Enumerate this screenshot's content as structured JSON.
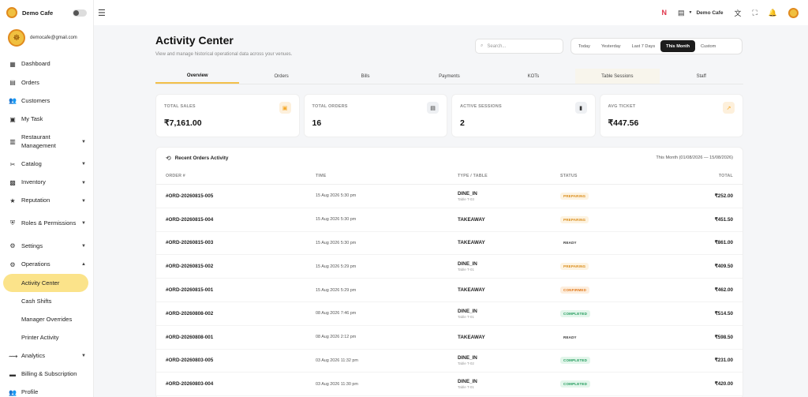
{
  "sidebar": {
    "brand_name": "Demo Cafe",
    "user_email": "democafe@gmail.com",
    "items": [
      {
        "name": "sidebar-item-dashboard",
        "label": "Dashboard",
        "icon": "grid",
        "chev": ""
      },
      {
        "name": "sidebar-item-orders",
        "label": "Orders",
        "icon": "receipt",
        "chev": ""
      },
      {
        "name": "sidebar-item-customers",
        "label": "Customers",
        "icon": "people",
        "chev": ""
      },
      {
        "name": "sidebar-item-my-task",
        "label": "My Task",
        "icon": "task",
        "chev": ""
      },
      {
        "name": "sidebar-item-restaurant-management",
        "label": "Restaurant Management",
        "icon": "store",
        "chev": "▼",
        "tall": true
      },
      {
        "name": "sidebar-item-catalog",
        "label": "Catalog",
        "icon": "utensils",
        "chev": "▼"
      },
      {
        "name": "sidebar-item-inventory",
        "label": "Inventory",
        "icon": "box",
        "chev": "▼"
      },
      {
        "name": "sidebar-item-reputation",
        "label": "Reputation",
        "icon": "star",
        "chev": "▼"
      },
      {
        "name": "sidebar-item-roles-permissions",
        "label": "Roles & Permissions",
        "icon": "shield",
        "chev": "▼",
        "tall": true
      },
      {
        "name": "sidebar-item-settings",
        "label": "Settings",
        "icon": "gear",
        "chev": "▼"
      },
      {
        "name": "sidebar-item-operations",
        "label": "Operations",
        "icon": "ops",
        "chev": "▲"
      }
    ],
    "sub_items": [
      {
        "label": "Activity Center",
        "active": true
      },
      {
        "label": "Cash Shifts",
        "active": false
      },
      {
        "label": "Manager Overrides",
        "active": false
      },
      {
        "label": "Printer Activity",
        "active": false
      }
    ],
    "items_after": [
      {
        "name": "sidebar-item-analytics",
        "label": "Analytics",
        "icon": "chart",
        "chev": "▼"
      },
      {
        "name": "sidebar-item-billing-subscription",
        "label": "Billing & Subscription",
        "icon": "card",
        "chev": ""
      },
      {
        "name": "sidebar-item-profile",
        "label": "Profile",
        "icon": "people",
        "chev": ""
      }
    ]
  },
  "topbar": {
    "venue": "Demo Cafe"
  },
  "page": {
    "title": "Activity Center",
    "subtitle": "View and manage historical operational data across your venues.",
    "search_placeholder": "Search..."
  },
  "date_range": [
    {
      "label": "Today",
      "active": false
    },
    {
      "label": "Yesterday",
      "active": false
    },
    {
      "label": "Last 7 Days",
      "active": false
    },
    {
      "label": "This Month",
      "active": true
    },
    {
      "label": "Custom",
      "active": false
    }
  ],
  "tabs": [
    {
      "label": "Overview",
      "active": true
    },
    {
      "label": "Orders"
    },
    {
      "label": "Bills"
    },
    {
      "label": "Payments"
    },
    {
      "label": "KOTs"
    },
    {
      "label": "Table Sessions",
      "hover": true
    },
    {
      "label": "Staff"
    }
  ],
  "stats": [
    {
      "label": "TOTAL SALES",
      "value": "₹7,161.00",
      "icon": "cash-icon",
      "color": "#f5a623",
      "bg": "#fdf0dc"
    },
    {
      "label": "TOTAL ORDERS",
      "value": "16",
      "icon": "receipt-icon",
      "color": "#333",
      "bg": "#eef0f3"
    },
    {
      "label": "ACTIVE SESSIONS",
      "value": "2",
      "icon": "door-icon",
      "color": "#333",
      "bg": "#eef0f3"
    },
    {
      "label": "AVG TICKET",
      "value": "₹447.56",
      "icon": "trend-up-icon",
      "color": "#f5a623",
      "bg": "#fdf0dc"
    }
  ],
  "recent": {
    "title": "Recent Orders Activity",
    "range": "This Month (01/08/2026 — 15/08/2026)",
    "columns": [
      "ORDER #",
      "TIME",
      "TYPE / TABLE",
      "STATUS",
      "TOTAL"
    ],
    "rows": [
      {
        "order": "#ORD-20260815-005",
        "time": "15 Aug 2026 5:30 pm",
        "type": "DINE_IN",
        "table": "Table T-03",
        "status": "PREPARING",
        "total": "₹252.00"
      },
      {
        "order": "#ORD-20260815-004",
        "time": "15 Aug 2026 5:30 pm",
        "type": "TAKEAWAY",
        "table": "",
        "status": "PREPARING",
        "total": "₹451.50"
      },
      {
        "order": "#ORD-20260815-003",
        "time": "15 Aug 2026 5:30 pm",
        "type": "TAKEAWAY",
        "table": "",
        "status": "READY",
        "total": "₹861.00"
      },
      {
        "order": "#ORD-20260815-002",
        "time": "15 Aug 2026 5:29 pm",
        "type": "DINE_IN",
        "table": "Table T-01",
        "status": "PREPARING",
        "total": "₹409.50"
      },
      {
        "order": "#ORD-20260815-001",
        "time": "15 Aug 2026 5:29 pm",
        "type": "TAKEAWAY",
        "table": "",
        "status": "CONFIRMED",
        "total": "₹462.00"
      },
      {
        "order": "#ORD-20260808-002",
        "time": "08 Aug 2026 7:46 pm",
        "type": "DINE_IN",
        "table": "Table T-01",
        "status": "COMPLETED",
        "total": "₹514.50"
      },
      {
        "order": "#ORD-20260808-001",
        "time": "08 Aug 2026 2:12 pm",
        "type": "TAKEAWAY",
        "table": "",
        "status": "READY",
        "total": "₹598.50"
      },
      {
        "order": "#ORD-20260803-005",
        "time": "03 Aug 2026 11:32 pm",
        "type": "DINE_IN",
        "table": "Table T-02",
        "status": "COMPLETED",
        "total": "₹231.00"
      },
      {
        "order": "#ORD-20260803-004",
        "time": "03 Aug 2026 11:30 pm",
        "type": "DINE_IN",
        "table": "Table T-01",
        "status": "COMPLETED",
        "total": "₹420.00"
      }
    ]
  }
}
